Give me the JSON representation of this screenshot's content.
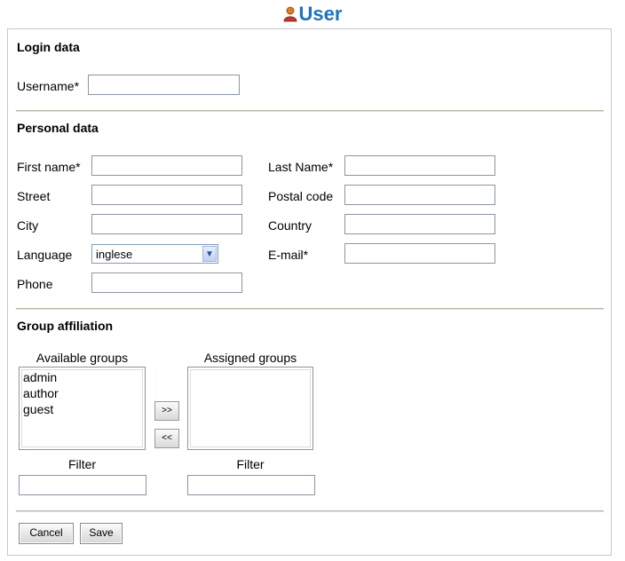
{
  "page": {
    "title": "User",
    "title_icon": "user-icon"
  },
  "login": {
    "heading": "Login data",
    "username_label": "Username*",
    "username_value": ""
  },
  "personal": {
    "heading": "Personal data",
    "first_name_label": "First name*",
    "last_name_label": "Last Name*",
    "street_label": "Street",
    "postal_code_label": "Postal code",
    "city_label": "City",
    "country_label": "Country",
    "language_label": "Language",
    "language_value": "inglese",
    "email_label": "E-mail*",
    "phone_label": "Phone"
  },
  "groups": {
    "heading": "Group affiliation",
    "available_label": "Available groups",
    "available": [
      "admin",
      "author",
      "guest"
    ],
    "assigned_label": "Assigned groups",
    "assigned": [],
    "add_label": ">>",
    "remove_label": "<<",
    "filter_label_left": "Filter",
    "filter_label_right": "Filter"
  },
  "actions": {
    "cancel_label": "Cancel",
    "save_label": "Save"
  },
  "colors": {
    "title": "#1e73be",
    "separator": "#b7b2a6"
  }
}
